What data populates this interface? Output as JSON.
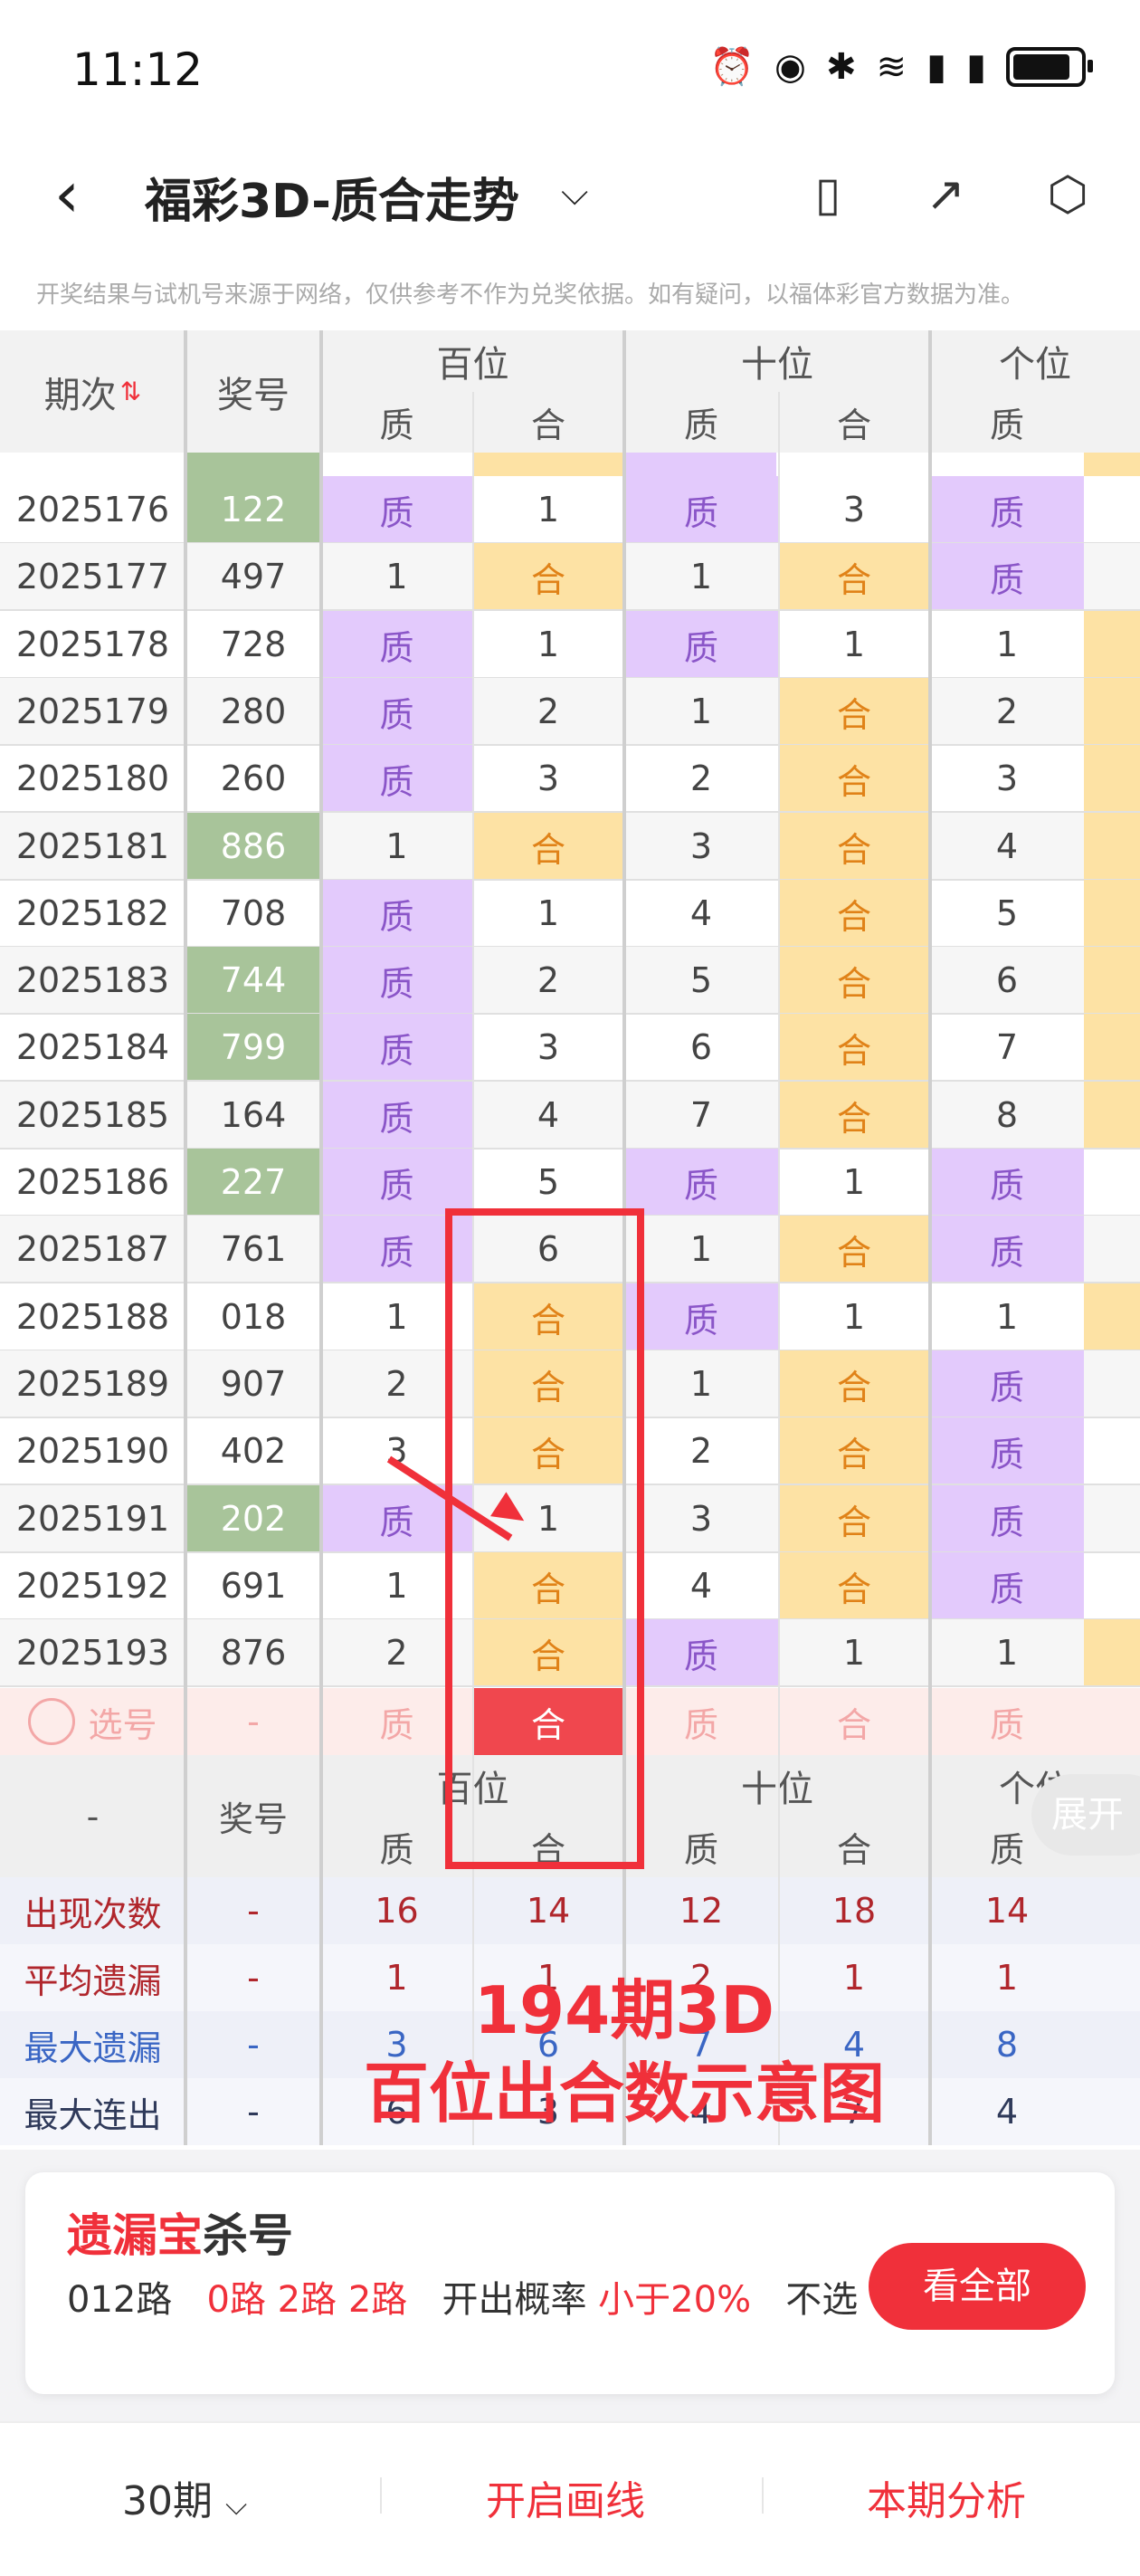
{
  "status": {
    "time": "11:12"
  },
  "appbar": {
    "title": "福彩3D-质合走势"
  },
  "notice": "开奖结果与试机号来源于网络，仅供参考不作为兑奖依据。如有疑问，以福体彩官方数据为准。",
  "header": {
    "period": "期次",
    "number": "奖号",
    "groups": [
      "百位",
      "十位",
      "个位"
    ],
    "sub": [
      "质",
      "合",
      "质",
      "合",
      "质"
    ]
  },
  "rows": [
    {
      "p": "2025176",
      "n": "122",
      "g": true,
      "c": [
        "质",
        "1",
        "质",
        "3",
        "质"
      ],
      "t": [
        "z",
        "p",
        "z",
        "p",
        "z"
      ],
      "x": "p"
    },
    {
      "p": "2025177",
      "n": "497",
      "g": false,
      "c": [
        "1",
        "合",
        "1",
        "合",
        "质"
      ],
      "t": [
        "p",
        "h",
        "p",
        "h",
        "z"
      ],
      "x": "p"
    },
    {
      "p": "2025178",
      "n": "728",
      "g": false,
      "c": [
        "质",
        "1",
        "质",
        "1",
        "1"
      ],
      "t": [
        "z",
        "p",
        "z",
        "p",
        "p"
      ],
      "x": "h"
    },
    {
      "p": "2025179",
      "n": "280",
      "g": false,
      "c": [
        "质",
        "2",
        "1",
        "合",
        "2"
      ],
      "t": [
        "z",
        "p",
        "p",
        "h",
        "p"
      ],
      "x": "h"
    },
    {
      "p": "2025180",
      "n": "260",
      "g": false,
      "c": [
        "质",
        "3",
        "2",
        "合",
        "3"
      ],
      "t": [
        "z",
        "p",
        "p",
        "h",
        "p"
      ],
      "x": "h"
    },
    {
      "p": "2025181",
      "n": "886",
      "g": true,
      "c": [
        "1",
        "合",
        "3",
        "合",
        "4"
      ],
      "t": [
        "p",
        "h",
        "p",
        "h",
        "p"
      ],
      "x": "h"
    },
    {
      "p": "2025182",
      "n": "708",
      "g": false,
      "c": [
        "质",
        "1",
        "4",
        "合",
        "5"
      ],
      "t": [
        "z",
        "p",
        "p",
        "h",
        "p"
      ],
      "x": "h"
    },
    {
      "p": "2025183",
      "n": "744",
      "g": true,
      "c": [
        "质",
        "2",
        "5",
        "合",
        "6"
      ],
      "t": [
        "z",
        "p",
        "p",
        "h",
        "p"
      ],
      "x": "h"
    },
    {
      "p": "2025184",
      "n": "799",
      "g": true,
      "c": [
        "质",
        "3",
        "6",
        "合",
        "7"
      ],
      "t": [
        "z",
        "p",
        "p",
        "h",
        "p"
      ],
      "x": "h"
    },
    {
      "p": "2025185",
      "n": "164",
      "g": false,
      "c": [
        "质",
        "4",
        "7",
        "合",
        "8"
      ],
      "t": [
        "z",
        "p",
        "p",
        "h",
        "p"
      ],
      "x": "h"
    },
    {
      "p": "2025186",
      "n": "227",
      "g": true,
      "c": [
        "质",
        "5",
        "质",
        "1",
        "质"
      ],
      "t": [
        "z",
        "p",
        "z",
        "p",
        "z"
      ],
      "x": "p"
    },
    {
      "p": "2025187",
      "n": "761",
      "g": false,
      "c": [
        "质",
        "6",
        "1",
        "合",
        "质"
      ],
      "t": [
        "z",
        "p",
        "p",
        "h",
        "z"
      ],
      "x": "p"
    },
    {
      "p": "2025188",
      "n": "018",
      "g": false,
      "c": [
        "1",
        "合",
        "质",
        "1",
        "1"
      ],
      "t": [
        "p",
        "h",
        "z",
        "p",
        "p"
      ],
      "x": "h"
    },
    {
      "p": "2025189",
      "n": "907",
      "g": false,
      "c": [
        "2",
        "合",
        "1",
        "合",
        "质"
      ],
      "t": [
        "p",
        "h",
        "p",
        "h",
        "z"
      ],
      "x": "p"
    },
    {
      "p": "2025190",
      "n": "402",
      "g": false,
      "c": [
        "3",
        "合",
        "2",
        "合",
        "质"
      ],
      "t": [
        "p",
        "h",
        "p",
        "h",
        "z"
      ],
      "x": "p"
    },
    {
      "p": "2025191",
      "n": "202",
      "g": true,
      "c": [
        "质",
        "1",
        "3",
        "合",
        "质"
      ],
      "t": [
        "z",
        "p",
        "p",
        "h",
        "z"
      ],
      "x": "p"
    },
    {
      "p": "2025192",
      "n": "691",
      "g": false,
      "c": [
        "1",
        "合",
        "4",
        "合",
        "质"
      ],
      "t": [
        "p",
        "h",
        "p",
        "h",
        "z"
      ],
      "x": "p"
    },
    {
      "p": "2025193",
      "n": "876",
      "g": false,
      "c": [
        "2",
        "合",
        "质",
        "1",
        "1"
      ],
      "t": [
        "p",
        "h",
        "z",
        "p",
        "p"
      ],
      "x": "h"
    }
  ],
  "select_row": {
    "label": "选号",
    "number": "-",
    "cells": [
      "质",
      "合",
      "质",
      "合",
      "质"
    ]
  },
  "bottom_header": {
    "period": "-",
    "number": "奖号",
    "groups": [
      "百位",
      "十位",
      "个位"
    ],
    "sub": [
      "质",
      "合",
      "质",
      "合",
      "质"
    ]
  },
  "stats": [
    {
      "label": "出现次数",
      "dash": "-",
      "vals": [
        "16",
        "14",
        "12",
        "18",
        "14"
      ],
      "color": "#b0262c"
    },
    {
      "label": "平均遗漏",
      "dash": "-",
      "vals": [
        "1",
        "1",
        "2",
        "1",
        "1"
      ],
      "color": "#b0262c"
    },
    {
      "label": "最大遗漏",
      "dash": "-",
      "vals": [
        "3",
        "6",
        "7",
        "4",
        "8"
      ],
      "color": "#3a66c4"
    },
    {
      "label": "最大连出",
      "dash": "-",
      "vals": [
        "6",
        "3",
        "4",
        "7",
        "4"
      ],
      "color": "#2f3a5a"
    }
  ],
  "expand_label": "展开",
  "annotation": {
    "line1": "194期3D",
    "line2": "百位出合数示意图"
  },
  "card": {
    "title_red": "遗漏宝",
    "title_black": "杀号",
    "route": "012路",
    "route_vals": "0路 2路 2路",
    "prob_label": "开出概率",
    "prob_val": "小于20%",
    "tail": "不选",
    "button": "看全部"
  },
  "footer": {
    "periods": "30期",
    "draw": "开启画线",
    "analysis": "本期分析"
  },
  "colors": {
    "zhi": "#e3cafc",
    "he": "#fde2a4",
    "green": "#a8c49a",
    "accent": "#f0303a"
  }
}
